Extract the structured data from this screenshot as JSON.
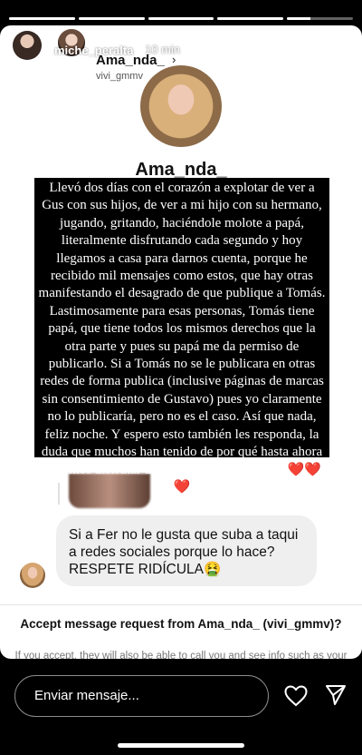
{
  "story": {
    "progress": [
      1,
      1,
      1,
      1,
      0.35
    ],
    "username": "miche_peralta",
    "time": "10 min",
    "more_icon": "more-icon",
    "close_icon": "close-icon"
  },
  "dm": {
    "title": "Ama_nda_",
    "chevron": "›",
    "subtitle": "vivi_gmmv",
    "profile_name": "Ama_nda_",
    "profile_handle": "vivi_gmmv",
    "message": "Si a Fer no le gusta que suba a taqui a redes sociales porque lo hace? RESPETE RIDÍCULA🤮",
    "request_title": "Accept message request from Ama_nda_ (vivi_gmmv)?",
    "request_desc": "If you accept, they will also be able to call you and see info such as your activity status and when you've read messages."
  },
  "overlay": {
    "text": "Llevó dos días con el corazón a explotar de ver a Gus con sus hijos, de ver a mi hijo con su hermano, jugando, gritando, haciéndole molote a papá, literalmente disfrutando cada segundo y hoy llegamos a casa para darnos cuenta, porque he recibido mil mensajes como estos, que hay otras manifestando el desagrado de que publique a Tomás. Lastimosamente para esas personas, Tomás tiene papá, que tiene todos los mismos derechos que la otra parte y pues su papá me da permiso de publicarlo. Si a Tomás no se le publicara en otras redes de forma publica (inclusive páginas de marcas sin consentimiento de Gustavo) pues yo claramente no lo publicaría, pero no es el caso. Así que nada, feliz noche. Y espero esto también les responda, la duda que muchos han tenido de por qué hasta ahora podemos disfrutar de Tomás. Buenas noches ❤️❤️❤️"
  },
  "footer": {
    "input_placeholder": "Enviar mensaje...",
    "heart_icon": "heart-icon",
    "send_icon": "send-icon"
  }
}
